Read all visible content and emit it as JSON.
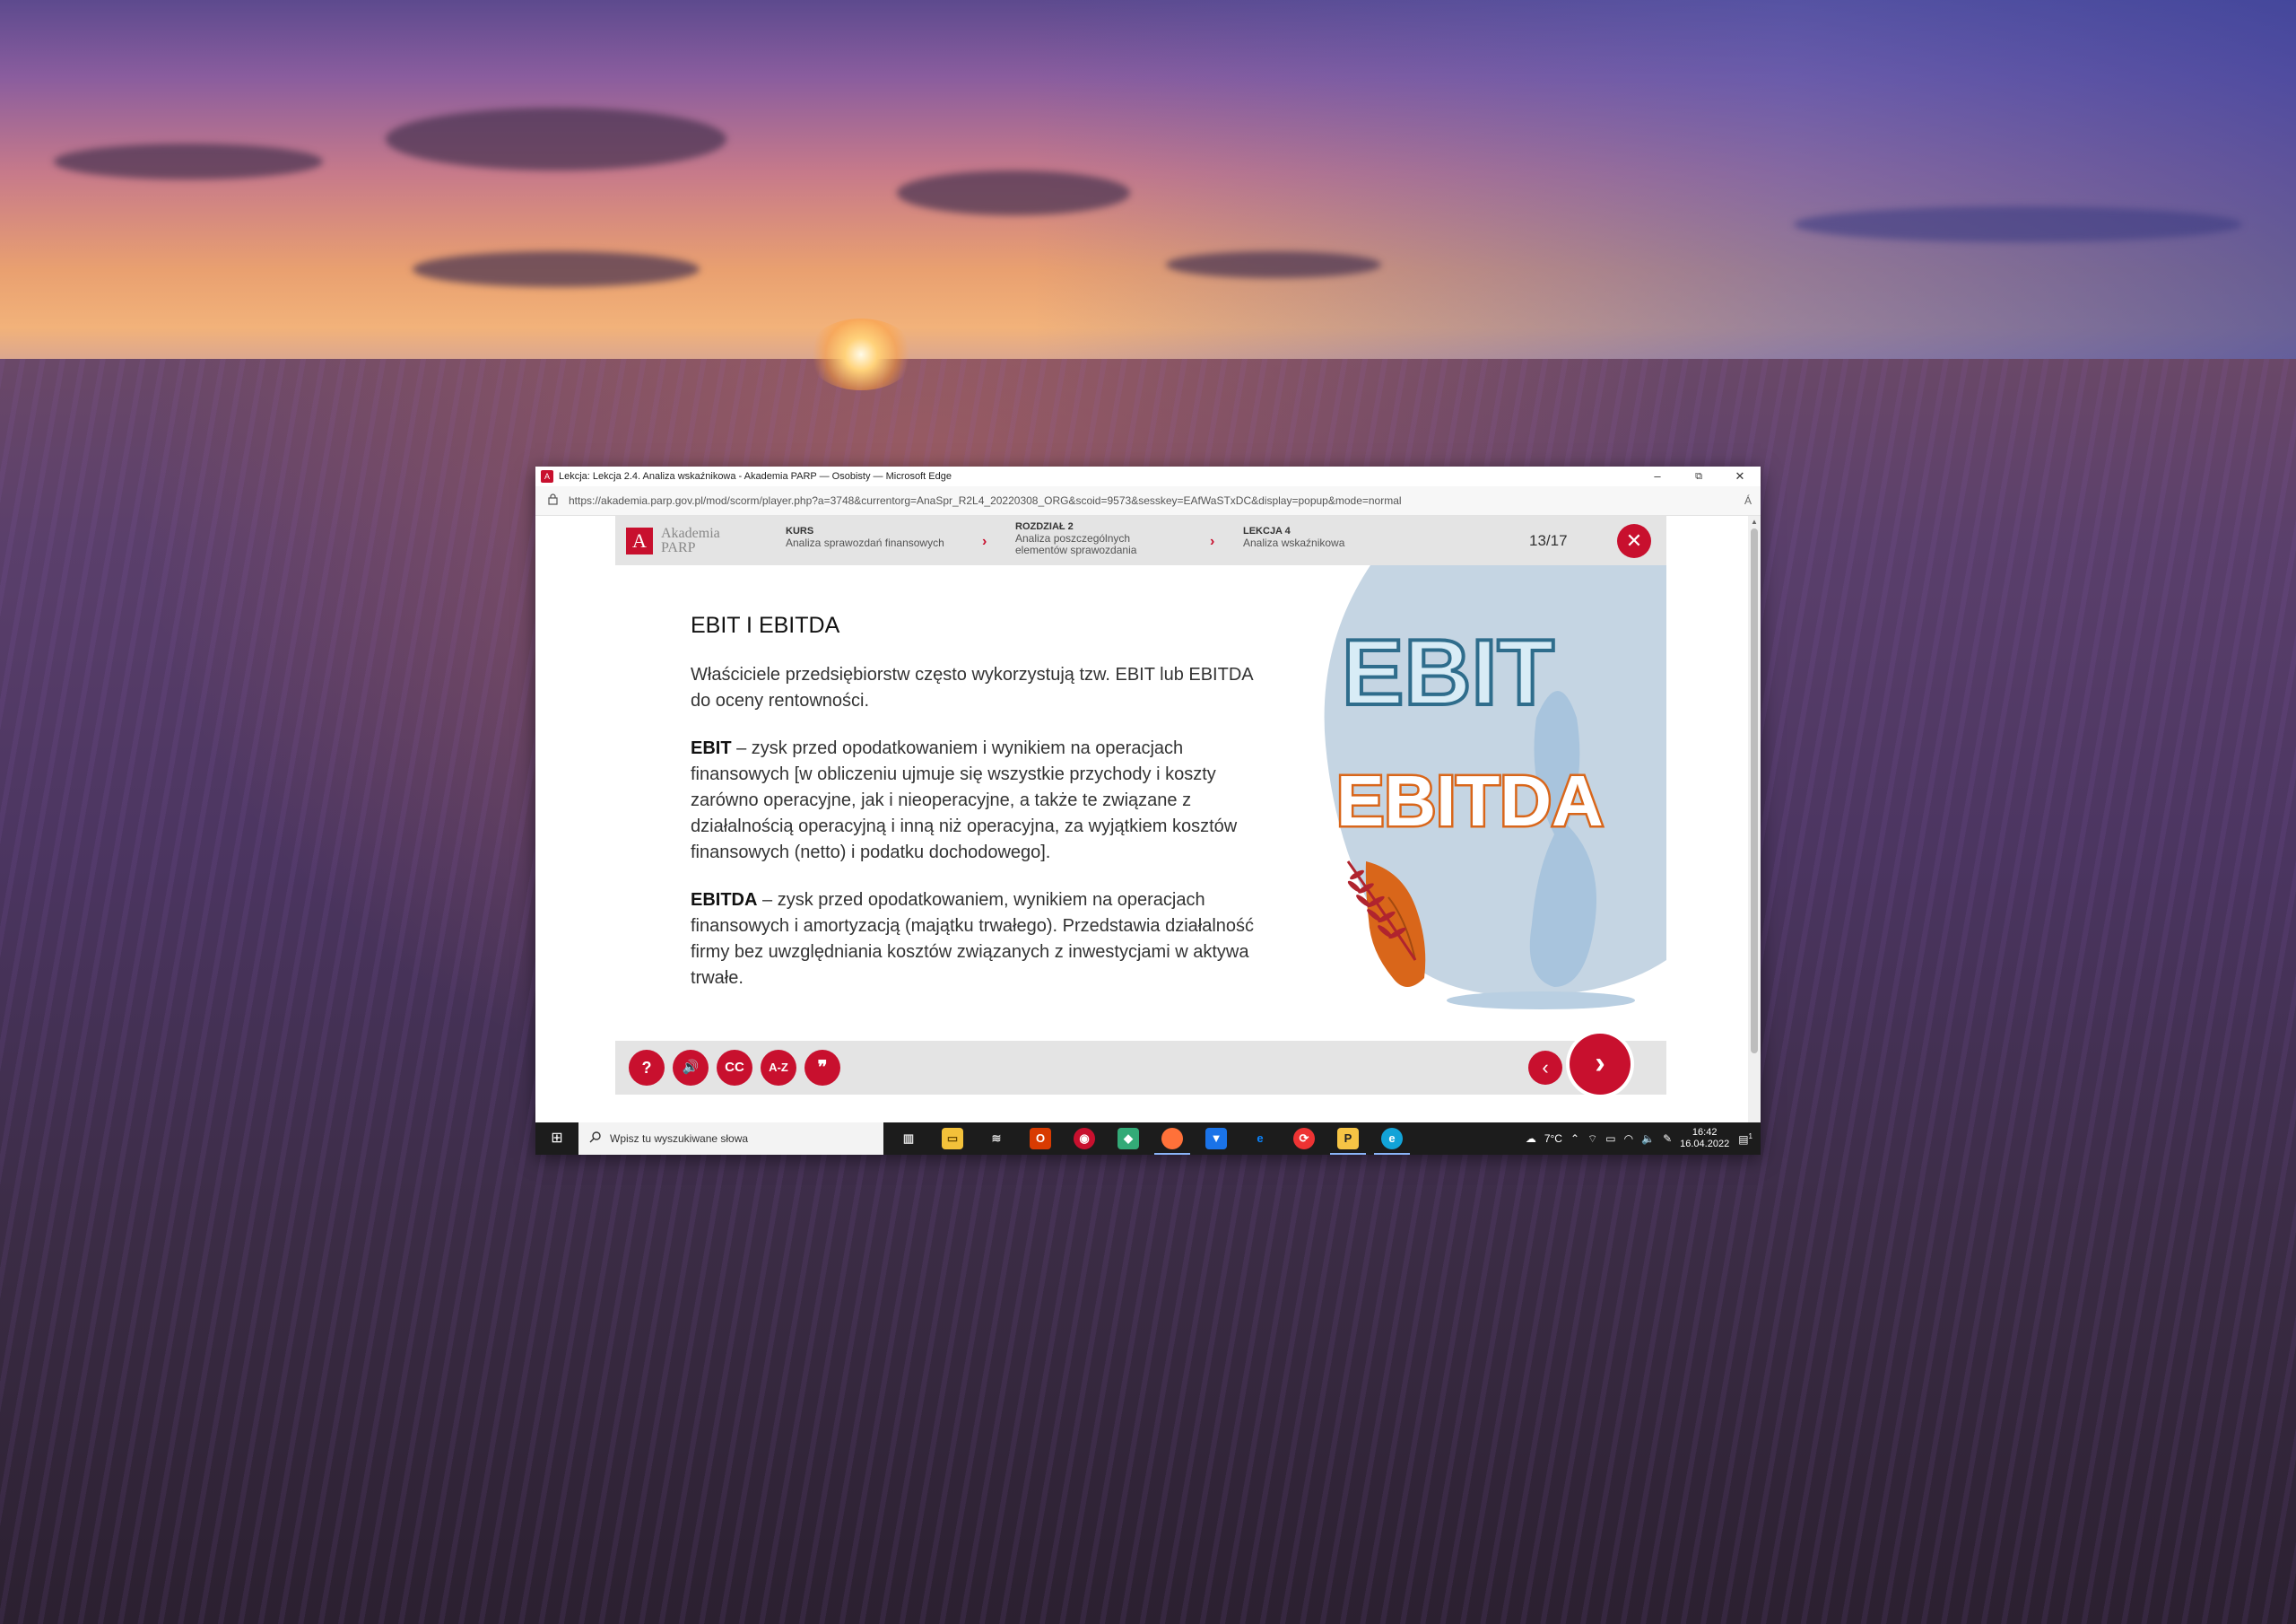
{
  "browser": {
    "title": "Lekcja: Lekcja 2.4. Analiza wskaźnikowa - Akademia PARP — Osobisty — Microsoft Edge",
    "url": "https://akademia.parp.gov.pl/mod/scorm/player.php?a=3748&currentorg=AnaSpr_R2L4_20220308_ORG&scoid=9573&sesskey=EAfWaSTxDC&display=popup&mode=normal",
    "controls": {
      "minimize": "–",
      "restore": "⧉",
      "close": "✕"
    },
    "reader_icon": "Á"
  },
  "header": {
    "logo_line1": "Akademia",
    "logo_line2": "PARP",
    "logo_mark": "A",
    "breadcrumbs": [
      {
        "caption": "KURS",
        "text": "Analiza sprawozdań finansowych"
      },
      {
        "caption": "ROZDZIAŁ 2",
        "text": "Analiza poszczególnych elementów sprawozdania"
      },
      {
        "caption": "LEKCJA 4",
        "text": "Analiza wskaźnikowa"
      }
    ],
    "separator": "›",
    "page_counter": "13/17",
    "close_icon": "✕"
  },
  "slide": {
    "title": "EBIT I EBITDA",
    "intro": "Właściciele przedsiębiorstw często wykorzystują tzw. EBIT lub EBITDA do oceny rentowności.",
    "ebit_term": "EBIT",
    "ebit_def": " – zysk przed opodatkowaniem i wynikiem na operacjach finansowych [w obliczeniu ujmuje się wszystkie przychody i koszty zarówno operacyjne, jak i nieoperacyjne, a także te związane z działalnością operacyjną i inną niż operacyjna, za wyjątkiem kosztów finansowych (netto) i podatku dochodowego].",
    "ebitda_term": "EBITDA",
    "ebitda_def": " – zysk przed opodatkowaniem, wynikiem na operacjach finansowych i amortyzacją (majątku trwałego). Przedstawia działalność firmy bez uwzględniania kosztów związanych z inwestycjami w aktywa trwałe.",
    "illustration_word1": "EBIT",
    "illustration_word2": "EBITDA",
    "colors": {
      "accent": "#c8102e",
      "ebit_fill": "#d8ecf6",
      "ebit_stroke": "#2f6d8c",
      "ebitda_fill": "#ffffff",
      "ebitda_stroke": "#d9661a"
    }
  },
  "controls": {
    "help": "?",
    "audio_icon": "speaker-icon",
    "audio": "🔊",
    "captions": "CC",
    "glossary": "A-Z",
    "quote": "❞",
    "prev": "‹",
    "next": "›"
  },
  "taskbar": {
    "start": "⊞",
    "search_placeholder": "Wpisz tu wyszukiwane słowa",
    "weather": "7°C",
    "time": "16:42",
    "date": "16.04.2022",
    "notifications": "1"
  }
}
